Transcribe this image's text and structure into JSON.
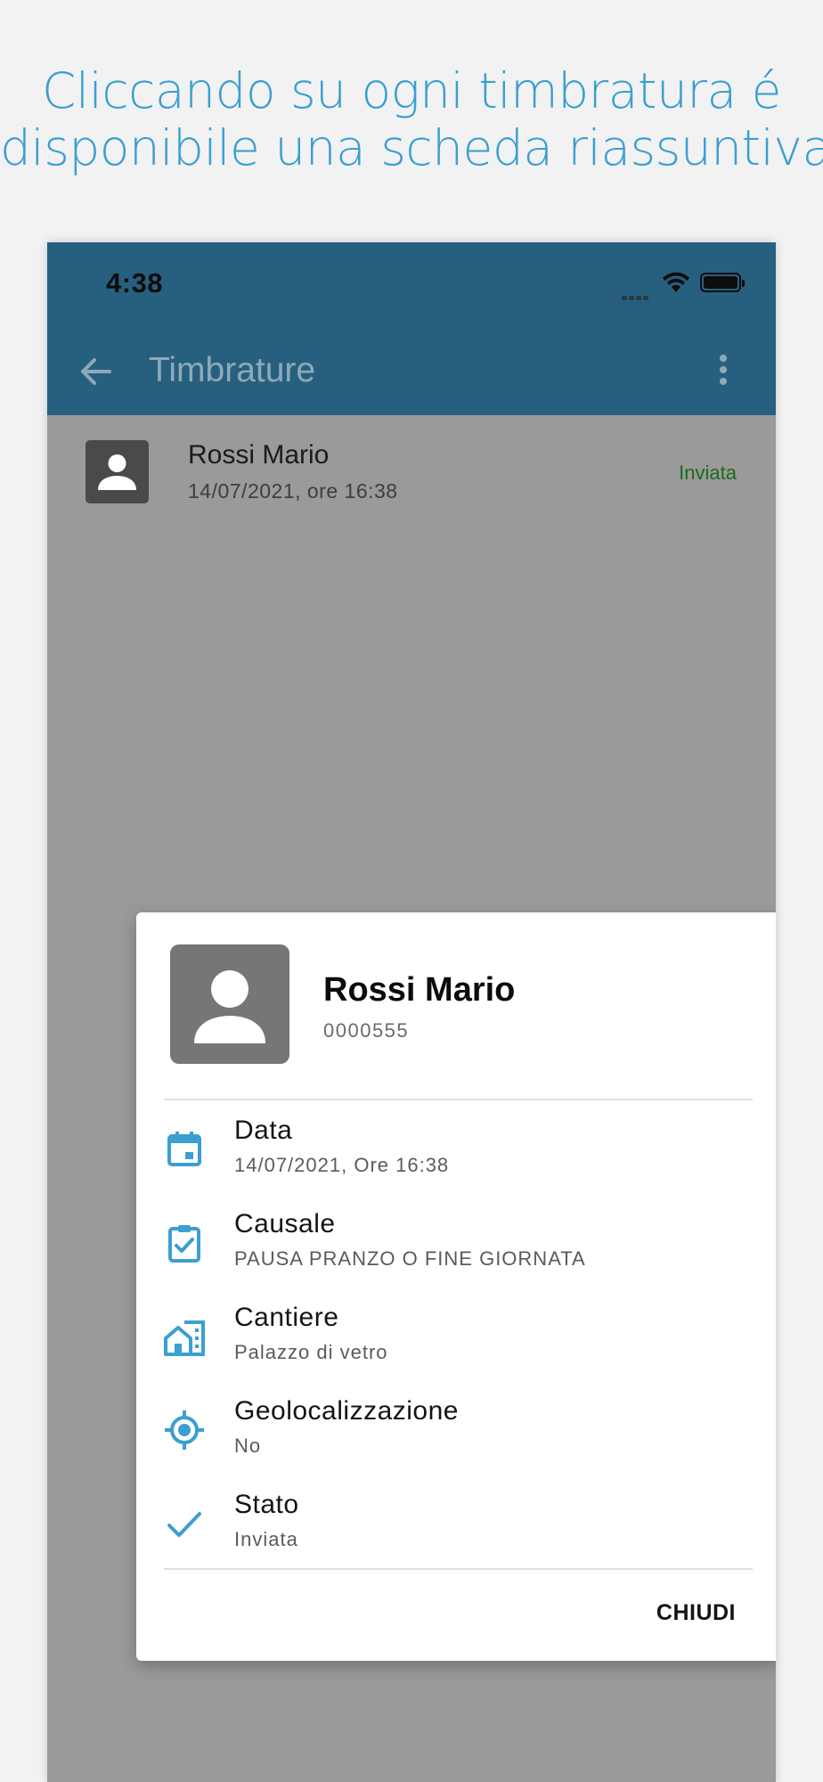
{
  "headline": {
    "line1": "Cliccando su ogni timbratura é",
    "line2": "disponibile una scheda riassuntiva"
  },
  "status_bar": {
    "time": "4:38"
  },
  "app_bar": {
    "title": "Timbrature"
  },
  "list": {
    "items": [
      {
        "name": "Rossi Mario",
        "datetime": "14/07/2021, ore 16:38",
        "status": "Inviata"
      }
    ]
  },
  "dialog": {
    "name": "Rossi Mario",
    "code": "0000555",
    "fields": [
      {
        "icon": "calendar-icon",
        "label": "Data",
        "value": "14/07/2021, Ore 16:38"
      },
      {
        "icon": "clipboard-check-icon",
        "label": "Causale",
        "value": "PAUSA PRANZO O FINE GIORNATA"
      },
      {
        "icon": "building-icon",
        "label": "Cantiere",
        "value": "Palazzo di vetro"
      },
      {
        "icon": "gps-location-icon",
        "label": "Geolocalizzazione",
        "value": "No"
      },
      {
        "icon": "check-icon",
        "label": "Stato",
        "value": "Inviata"
      }
    ],
    "close_label": "CHIUDI"
  },
  "colors": {
    "headline": "#3b9fd0",
    "app_bar": "#27607f",
    "accent_icon": "#3b9fd0",
    "status_sent": "#1b6b1b",
    "scrim": "#9a9a9a"
  }
}
